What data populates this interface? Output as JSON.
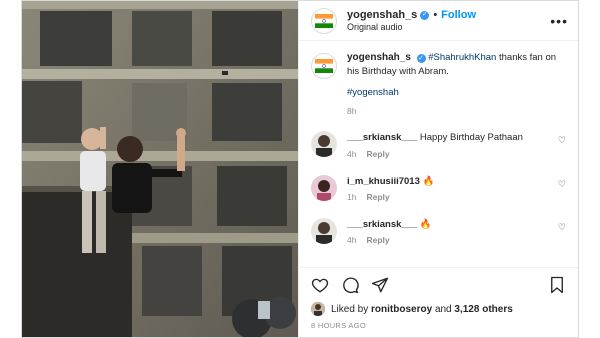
{
  "post": {
    "username": "yogenshah_s",
    "follow_label": "Follow",
    "audio": "Original audio",
    "dot": "•",
    "caption": {
      "username": "yogenshah_s",
      "mention": "#ShahrukhKhan",
      "text": "thanks fan on his Birthday with Abram.",
      "hashtag": "#yogenshah",
      "time": "8h"
    },
    "comments": [
      {
        "username": "___srkiansk___",
        "text": "Happy Birthday Pathaan",
        "time": "4h",
        "reply": "Reply"
      },
      {
        "username": "i_m_khusiii7013",
        "text": "🔥",
        "time": "1h",
        "reply": "Reply"
      },
      {
        "username": "___srkiansk___",
        "text": "🔥",
        "time": "4h",
        "reply": "Reply"
      }
    ],
    "likes": {
      "prefix": "Liked by",
      "user": "ronitboseroy",
      "middle": "and",
      "count": "3,128 others"
    },
    "posted_ago": "8 HOURS AGO"
  },
  "icons": {
    "more": "more-options-icon",
    "like": "heart-icon",
    "comment": "comment-icon",
    "share": "share-icon",
    "save": "bookmark-icon"
  },
  "colors": {
    "accent": "#0095f6",
    "verified": "#3897f0",
    "flag_saffron": "#ff9933",
    "flag_green": "#138808",
    "chakra": "#000080"
  }
}
